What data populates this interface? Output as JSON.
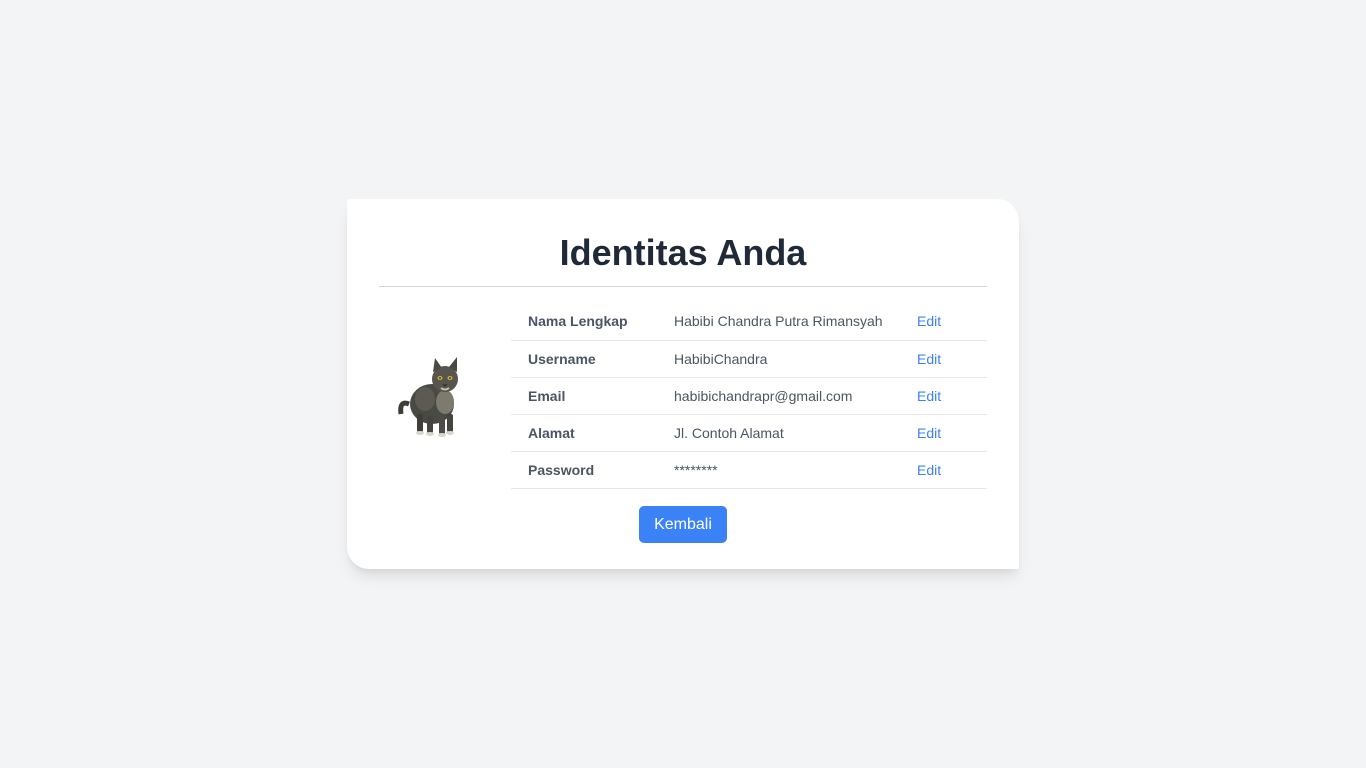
{
  "card": {
    "title": "Identitas Anda"
  },
  "avatar": {
    "icon": "cat-photo"
  },
  "fields": [
    {
      "label": "Nama Lengkap",
      "value": "Habibi Chandra Putra Rimansyah",
      "action": "Edit"
    },
    {
      "label": "Username",
      "value": "HabibiChandra",
      "action": "Edit"
    },
    {
      "label": "Email",
      "value": "habibichandrapr@gmail.com",
      "action": "Edit"
    },
    {
      "label": "Alamat",
      "value": "Jl. Contoh Alamat",
      "action": "Edit"
    },
    {
      "label": "Password",
      "value": "********",
      "action": "Edit"
    }
  ],
  "actions": {
    "back_label": "Kembali"
  },
  "colors": {
    "accent": "#3b82f6",
    "background": "#f3f4f6",
    "title": "#1f2937"
  }
}
